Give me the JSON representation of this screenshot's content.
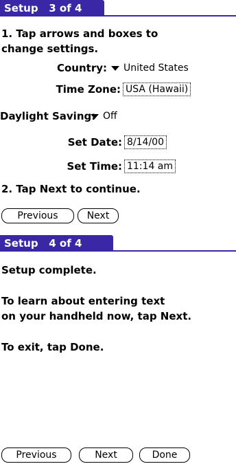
{
  "screen1": {
    "title": "Setup   3 of 4",
    "step1_line1": "1. Tap arrows and boxes to",
    "step1_line2": "change settings.",
    "country_label": "Country:",
    "country_value": "United States",
    "timezone_label": "Time Zone:",
    "timezone_value": "USA (Hawaii)",
    "dst_label": "Daylight Saving:",
    "dst_value": "Off",
    "date_label": "Set Date:",
    "date_value": "8/14/00",
    "time_label": "Set Time:",
    "time_value": "11:14 am",
    "step2": "2. Tap Next to continue.",
    "previous_label": "Previous",
    "next_label": "Next"
  },
  "screen2": {
    "title": "Setup   4 of 4",
    "line_complete": "Setup complete.",
    "line_learn1": "To learn about entering text",
    "line_learn2": "on your handheld now, tap Next.",
    "line_exit": "To exit, tap Done.",
    "previous_label": "Previous",
    "next_label": "Next",
    "done_label": "Done"
  },
  "colors": {
    "title_bar": "#3a27a6",
    "background": "#ffffff",
    "text": "#000000"
  },
  "icons": {
    "dropdown": "triangle-down-icon"
  }
}
